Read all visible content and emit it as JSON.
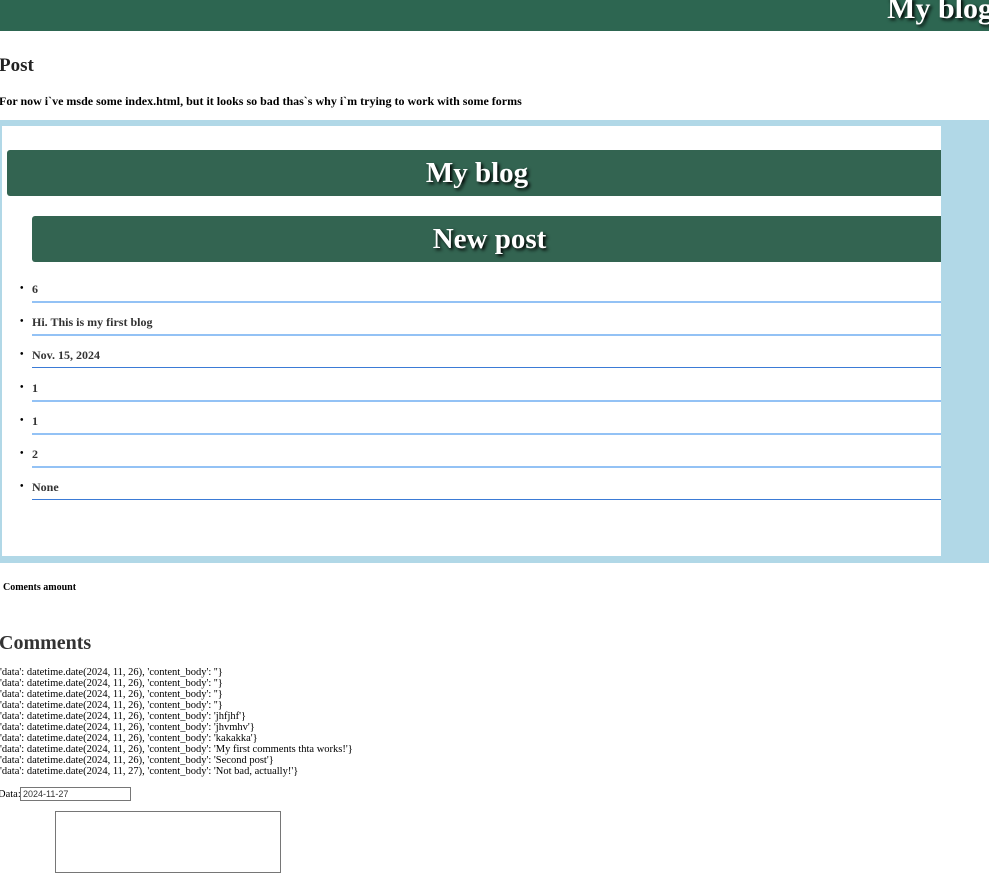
{
  "header": {
    "title": "My blog"
  },
  "post": {
    "heading": "Post",
    "description": "For now i`ve msde some index.html, but it looks so bad thas`s why i`m trying to work with some forms"
  },
  "embedded": {
    "title": "My blog",
    "subtitle": "New post",
    "items": [
      "6",
      "Hi. This is my first blog",
      "Nov. 15, 2024",
      "1",
      "1",
      "2",
      "None"
    ]
  },
  "comments_amount_label": "Coments amount",
  "comments": {
    "heading": "Comments",
    "lines": [
      "'data': datetime.date(2024, 11, 26), 'content_body': ''}",
      "'data': datetime.date(2024, 11, 26), 'content_body': ''}",
      "'data': datetime.date(2024, 11, 26), 'content_body': ''}",
      "'data': datetime.date(2024, 11, 26), 'content_body': ''}",
      "'data': datetime.date(2024, 11, 26), 'content_body': 'jhfjhf'}",
      "'data': datetime.date(2024, 11, 26), 'content_body': 'jhvmhv'}",
      "'data': datetime.date(2024, 11, 26), 'content_body': 'kakakka'}",
      "'data': datetime.date(2024, 11, 26), 'content_body': 'My first comments thta works!'}",
      "'data': datetime.date(2024, 11, 26), 'content_body': 'Second post'}",
      "'data': datetime.date(2024, 11, 27), 'content_body': 'Not bad, actually!'}"
    ]
  },
  "form": {
    "data_label": "Data:",
    "data_value": "2024-11-27"
  },
  "colors": {
    "header": "#2d6651",
    "frame": "#b1d8e7",
    "bar": "#336451"
  }
}
